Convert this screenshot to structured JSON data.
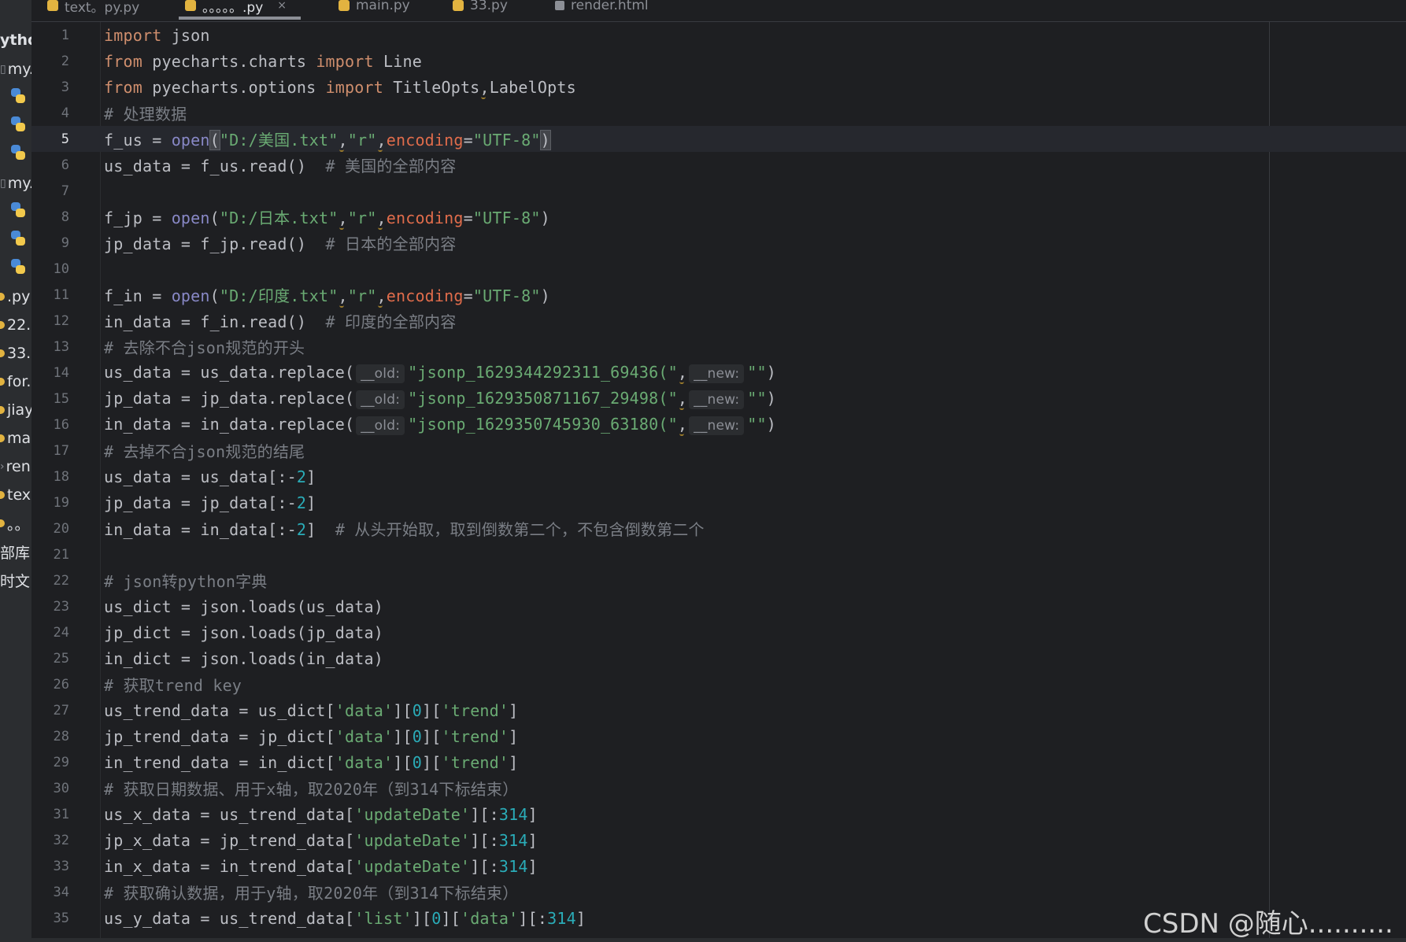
{
  "tabs": [
    {
      "label": "text。py.py",
      "active": false
    },
    {
      "label": "。。。。。.py",
      "active": true,
      "close": "×"
    },
    {
      "label": "main.py",
      "active": false
    },
    {
      "label": "33.py",
      "active": false
    },
    {
      "label": "render.html",
      "active": false
    }
  ],
  "sidebar": {
    "items": [
      {
        "label": "ytho"
      },
      {
        "label": "my."
      },
      {
        "label": "my."
      },
      {
        "label": ".py"
      },
      {
        "label": "22."
      },
      {
        "label": "33."
      },
      {
        "label": "for."
      },
      {
        "label": "jiay"
      },
      {
        "label": "mai"
      },
      {
        "label": "ren"
      },
      {
        "label": "tex"
      },
      {
        "label": "。。"
      },
      {
        "label": "部库"
      },
      {
        "label": "时文"
      }
    ]
  },
  "editor": {
    "current_line": 5,
    "lines": [
      {
        "n": "1"
      },
      {
        "n": "2"
      },
      {
        "n": "3"
      },
      {
        "n": "4"
      },
      {
        "n": "5"
      },
      {
        "n": "6"
      },
      {
        "n": "7"
      },
      {
        "n": "8"
      },
      {
        "n": "9"
      },
      {
        "n": "10"
      },
      {
        "n": "11"
      },
      {
        "n": "12"
      },
      {
        "n": "13"
      },
      {
        "n": "14"
      },
      {
        "n": "15"
      },
      {
        "n": "16"
      },
      {
        "n": "17"
      },
      {
        "n": "18"
      },
      {
        "n": "19"
      },
      {
        "n": "20"
      },
      {
        "n": "21"
      },
      {
        "n": "22"
      },
      {
        "n": "23"
      },
      {
        "n": "24"
      },
      {
        "n": "25"
      },
      {
        "n": "26"
      },
      {
        "n": "27"
      },
      {
        "n": "28"
      },
      {
        "n": "29"
      },
      {
        "n": "30"
      },
      {
        "n": "31"
      },
      {
        "n": "32"
      },
      {
        "n": "33"
      },
      {
        "n": "34"
      },
      {
        "n": "35"
      }
    ]
  },
  "code": {
    "kw_import": "import",
    "kw_from": "from",
    "mod_json": " json",
    "mod_pyecharts": " pyecharts.charts ",
    "name_line": " Line",
    "mod_options": " pyecharts.options ",
    "name_titleopts": " TitleOpts",
    "name_labelopts": "LabelOpts",
    "c4": "# 处理数据",
    "f_us_assign": "f_us = ",
    "f_jp_assign": "f_jp = ",
    "f_in_assign": "f_in = ",
    "fn_open": "open",
    "lp": "(",
    "rp": ")",
    "comma": ",",
    "s_us_path": "\"D:/美国.txt\"",
    "s_jp_path": "\"D:/日本.txt\"",
    "s_in_path": "\"D:/印度.txt\"",
    "s_r": "\"r\"",
    "p_encoding": "encoding",
    "eq": "=",
    "s_utf8": "\"UTF-8\"",
    "l6_code": "us_data = f_us.read()  ",
    "l6_cm": "# 美国的全部内容",
    "l9_code": "jp_data = f_jp.read()  ",
    "l9_cm": "# 日本的全部内容",
    "l12_code": "in_data = f_in.read()  ",
    "l12_cm": "# 印度的全部内容",
    "c13": "# 去除不合json规范的开头",
    "l14_code": "us_data = us_data.replace(",
    "l15_code": "jp_data = jp_data.replace(",
    "l16_code": "in_data = in_data.replace(",
    "hint_old": "__old:",
    "hint_new": "__new:",
    "s14": "\"jsonp_1629344292311_69436(\"",
    "s15": "\"jsonp_1629350871167_29498(\"",
    "s16": "\"jsonp_1629350745930_63180(\"",
    "s_empty": "\"\"",
    "c17": "# 去掉不合json规范的结尾",
    "l18_code": "us_data = us_data[:-",
    "l19_code": "jp_data = jp_data[:-",
    "l20_code": "in_data = in_data[:-",
    "n2": "2",
    "rb": "]",
    "l20_cm": "# 从头开始取，取到倒数第二个，不包含倒数第二个",
    "c22": "# json转python字典",
    "l23": "us_dict = json.loads(us_data)",
    "l24": "jp_dict = json.loads(jp_data)",
    "l25": "in_dict = json.loads(in_data)",
    "c26": "# 获取trend key",
    "l27_code": "us_trend_data = us_dict[",
    "l28_code": "jp_trend_data = jp_dict[",
    "l29_code": "in_trend_data = in_dict[",
    "s_data": "'data'",
    "s_trend": "'trend'",
    "s_list": "'list'",
    "s_update": "'updateDate'",
    "lb_rb": "][",
    "lb": "[",
    "n0": "0",
    "c30": "# 获取日期数据、用于x轴，取2020年（到314下标结束）",
    "l31_code": "us_x_data = us_trend_data[",
    "l32_code": "jp_x_data = jp_trend_data[",
    "l33_code": "in_x_data = in_trend_data[",
    "slice_open": "][:",
    "n314": "314",
    "c34": "# 获取确认数据，用于y轴，取2020年（到314下标结束）",
    "l35_code": "us_y_data = us_trend_data["
  },
  "watermark": "CSDN @随心..........",
  "colors": {
    "background": "#1e1f22",
    "keyword": "#cf8e6d",
    "string": "#6aab73",
    "number": "#2aacb8",
    "comment": "#7a7e85",
    "builtin": "#8888c6",
    "param": "#e06c4b"
  }
}
